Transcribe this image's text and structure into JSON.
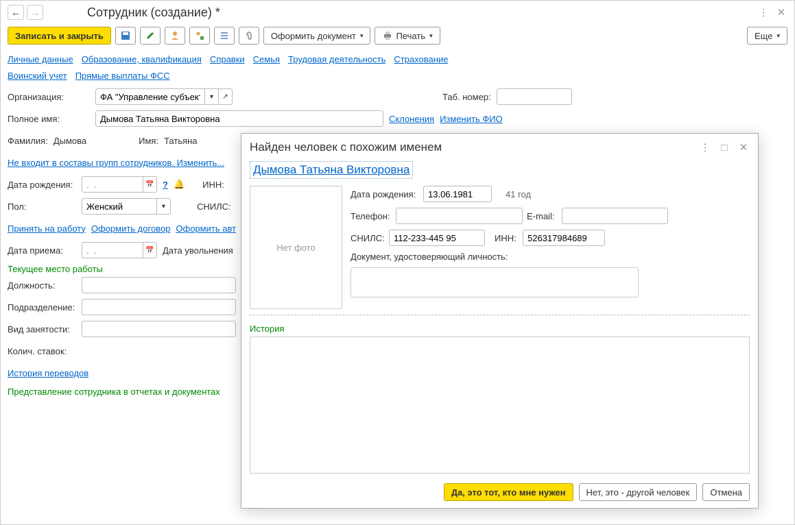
{
  "header": {
    "title": "Сотрудник (создание) *"
  },
  "toolbar": {
    "save_close": "Записать и закрыть",
    "doc_btn": "Оформить документ",
    "print_btn": "Печать",
    "more_btn": "Еще"
  },
  "tabs": {
    "personal": "Личные данные",
    "education": "Образование, квалификация",
    "references": "Справки",
    "family": "Семья",
    "labor": "Трудовая деятельность",
    "insurance": "Страхование",
    "military": "Воинский учет",
    "fss": "Прямые выплаты ФСС"
  },
  "form": {
    "org_label": "Организация:",
    "org_value": "ФА \"Управление субъекта",
    "tab_num_label": "Таб. номер:",
    "fullname_label": "Полное имя:",
    "fullname_value": "Дымова Татьяна Викторовна",
    "declension_link": "Склонения",
    "change_fio_link": "Изменить ФИО",
    "surname_label": "Фамилия:",
    "surname_value": "Дымова",
    "name_label": "Имя:",
    "name_value": "Татьяна",
    "groups_link": "Не входит в составы групп сотрудников. Изменить...",
    "birth_label": "Дата рождения:",
    "birth_placeholder": ".  .",
    "inn_label": "ИНН:",
    "sex_label": "Пол:",
    "sex_value": "Женский",
    "snils_label": "СНИЛС:",
    "hire_link": "Принять на работу",
    "contract_link": "Оформить договор",
    "author_link": "Оформить авт",
    "hire_date_label": "Дата приема:",
    "hire_date_placeholder": ".  .",
    "fire_date_label": "Дата увольнения",
    "current_place": "Текущее место работы",
    "position_label": "Должность:",
    "dept_label": "Подразделение:",
    "employment_label": "Вид занятости:",
    "rates_label": "Колич. ставок:",
    "transfers_link": "История переводов",
    "representation": "Представление сотрудника в отчетах и документах"
  },
  "dialog": {
    "title": "Найден человек с похожим именем",
    "person_name": "Дымова Татьяна Викторовна",
    "no_photo": "Нет фото",
    "birth_label": "Дата рождения:",
    "birth_value": "13.06.1981",
    "age": "41 год",
    "phone_label": "Телефон:",
    "email_label": "E-mail:",
    "snils_label": "СНИЛС:",
    "snils_value": "112-233-445 95",
    "inn_label": "ИНН:",
    "inn_value": "526317984689",
    "doc_label": "Документ, удостоверяющий личность:",
    "history": "История",
    "yes_btn": "Да, это тот, кто мне нужен",
    "no_btn": "Нет, это - другой человек",
    "cancel_btn": "Отмена"
  }
}
